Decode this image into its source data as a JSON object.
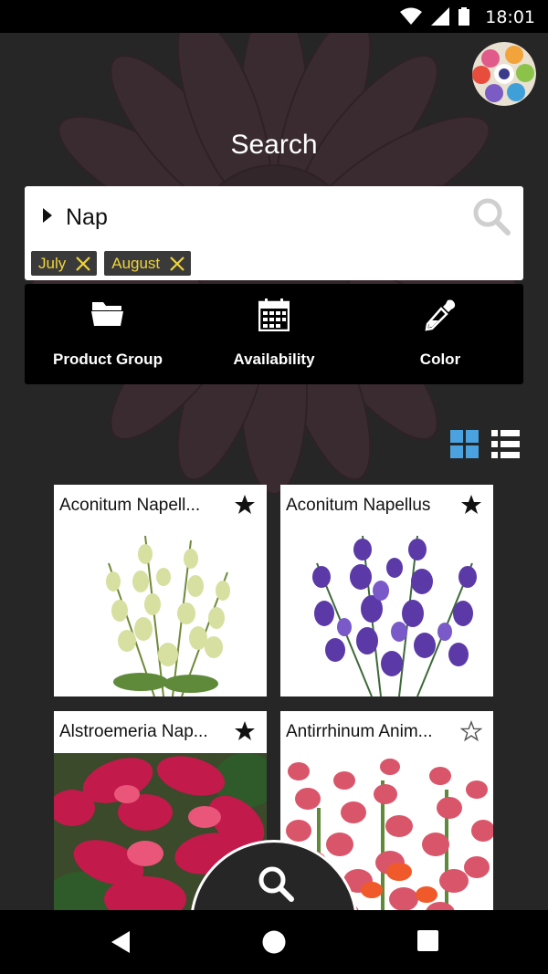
{
  "status_bar": {
    "time": "18:01"
  },
  "header": {
    "title": "Search"
  },
  "search": {
    "query": "Nap",
    "chips": [
      {
        "label": "July"
      },
      {
        "label": "August"
      }
    ]
  },
  "filters": [
    {
      "label": "Product Group",
      "icon": "folder-icon"
    },
    {
      "label": "Availability",
      "icon": "calendar-icon"
    },
    {
      "label": "Color",
      "icon": "eyedropper-icon"
    }
  ],
  "products": [
    {
      "name": "Aconitum Napell...",
      "favorite": true
    },
    {
      "name": "Aconitum Napellus",
      "favorite": true
    },
    {
      "name": "Alstroemeria Nap...",
      "favorite": true
    },
    {
      "name": "Antirrhinum Anim...",
      "favorite": false
    }
  ],
  "colors": {
    "chip_text": "#f0d43a",
    "grid_toggle_active": "#4aa3df",
    "background": "#262626"
  }
}
